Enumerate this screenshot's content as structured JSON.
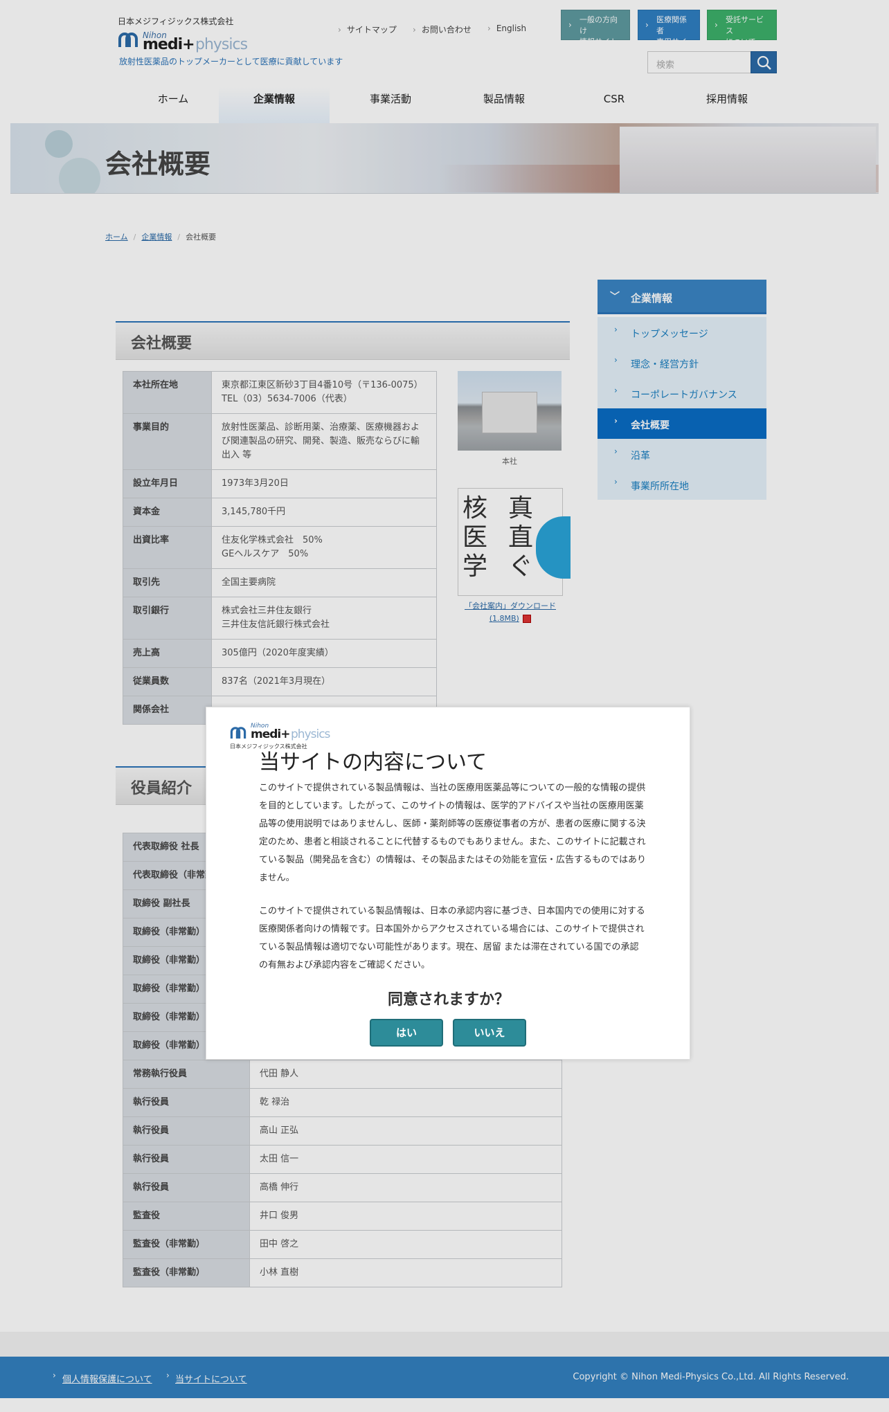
{
  "header": {
    "company_name": "日本メジフィジックス株式会社",
    "logo_nihon": "Nihon",
    "logo_medi": "medi+",
    "logo_physics": "physics",
    "tagline": "放射性医薬品のトップメーカーとして医療に貢献しています",
    "links": [
      "サイトマップ",
      "お問い合わせ",
      "English"
    ],
    "buttons": [
      {
        "line1": "一般の方向け",
        "line2": "情報サイト",
        "color": "#5e9aa0"
      },
      {
        "line1": "医療関係者",
        "line2": "専用サイト",
        "color": "#2f7fc2"
      },
      {
        "line1": "受託サービス",
        "line2": "について",
        "color": "#3db06a"
      }
    ],
    "search_placeholder": "検索"
  },
  "nav": [
    "ホーム",
    "企業情報",
    "事業活動",
    "製品情報",
    "CSR",
    "採用情報"
  ],
  "nav_active": "企業情報",
  "banner_title": "会社概要",
  "breadcrumb": {
    "home": "ホーム",
    "section": "企業情報",
    "current": "会社概要"
  },
  "overview": {
    "heading": "会社概要",
    "rows": [
      {
        "k": "本社所在地",
        "v": "東京都江東区新砂3丁目4番10号（〒136-0075）\nTEL（03）5634-7006（代表）"
      },
      {
        "k": "事業目的",
        "v": "放射性医薬品、診断用薬、治療薬、医療機器および関連製品の研究、開発、製造、販売ならびに輸出入 等"
      },
      {
        "k": "設立年月日",
        "v": "1973年3月20日"
      },
      {
        "k": "資本金",
        "v": "3,145,780千円"
      },
      {
        "k": "出資比率",
        "v": "住友化学株式会社　50%\nGEヘルスケア　50%"
      },
      {
        "k": "取引先",
        "v": "全国主要病院"
      },
      {
        "k": "取引銀行",
        "v": "株式会社三井住友銀行\n三井住友信託銀行株式会社"
      },
      {
        "k": "売上高",
        "v": "305億円（2020年度実績）"
      },
      {
        "k": "従業員数",
        "v": "837名（2021年3月現在）"
      },
      {
        "k": "関係会社",
        "v": ""
      }
    ],
    "photo1_caption": "本社",
    "photo2_kanji": [
      "核",
      "医",
      "学",
      "真",
      "直",
      "ぐ"
    ],
    "photo2_link_line1": "「会社案内」ダウンロード",
    "photo2_link_line2": "(1.8MB)"
  },
  "officers": {
    "heading": "役員紹介",
    "rows": [
      {
        "k": "代表取締役 社長",
        "v": ""
      },
      {
        "k": "代表取締役（非常勤）",
        "v": ""
      },
      {
        "k": "取締役 副社長",
        "v": ""
      },
      {
        "k": "取締役（非常勤）",
        "v": ""
      },
      {
        "k": "取締役（非常勤）",
        "v": ""
      },
      {
        "k": "取締役（非常勤）",
        "v": ""
      },
      {
        "k": "取締役（非常勤）",
        "v": ""
      },
      {
        "k": "取締役（非常勤）",
        "v": ""
      },
      {
        "k": "常務執行役員",
        "v": "代田 静人"
      },
      {
        "k": "執行役員",
        "v": "乾 禄治"
      },
      {
        "k": "執行役員",
        "v": "高山 正弘"
      },
      {
        "k": "執行役員",
        "v": "太田 信一"
      },
      {
        "k": "執行役員",
        "v": "高橋 伸行"
      },
      {
        "k": "監査役",
        "v": "井口 俊男"
      },
      {
        "k": "監査役（非常勤）",
        "v": "田中 啓之"
      },
      {
        "k": "監査役（非常勤）",
        "v": "小林 直樹"
      }
    ]
  },
  "sidebar": {
    "heading": "企業情報",
    "items": [
      "トップメッセージ",
      "理念・経営方針",
      "コーポレートガバナンス",
      "会社概要",
      "沿革",
      "事業所所在地"
    ],
    "active": "会社概要"
  },
  "modal": {
    "logo_sub": "日本メジフィジックス株式会社",
    "title": "当サイトの内容について",
    "para1": "このサイトで提供されている製品情報は、当社の医療用医薬品等についての一般的な情報の提供を目的としています。したがって、このサイトの情報は、医学的アドバイスや当社の医療用医薬品等の使用説明ではありませんし、医師・薬剤師等の医療従事者の方が、患者の医療に関する決定のため、患者と相談されることに代替するものでもありません。また、このサイトに記載されている製品（開発品を含む）の情報は、その製品またはその効能を宣伝・広告するものではありません。",
    "para2": "このサイトで提供されている製品情報は、日本の承認内容に基づき、日本国内での使用に対する医療関係者向けの情報です。日本国外からアクセスされている場合には、このサイトで提供されている製品情報は適切でない可能性があります。現在、居留 または滞在されている国での承認の有無および承認内容をご確認ください。",
    "question": "同意されますか？",
    "yes": "はい",
    "no": "いいえ"
  },
  "footer": {
    "links": [
      "個人情報保護について",
      "当サイトについて"
    ],
    "copyright": "Copyright © Nihon Medi-Physics Co.,Ltd. All Rights Reserved."
  }
}
